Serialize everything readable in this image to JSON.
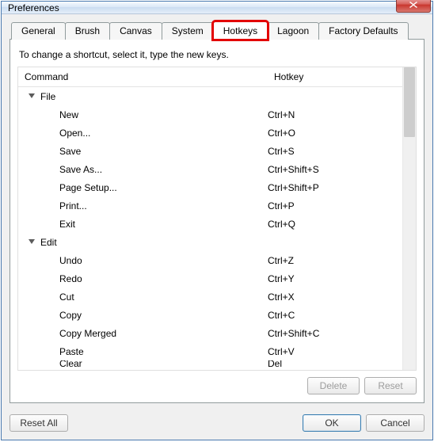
{
  "window": {
    "title": "Preferences"
  },
  "tabs": [
    {
      "label": "General"
    },
    {
      "label": "Brush"
    },
    {
      "label": "Canvas"
    },
    {
      "label": "System"
    },
    {
      "label": "Hotkeys",
      "active": true,
      "highlighted": true
    },
    {
      "label": "Lagoon"
    },
    {
      "label": "Factory Defaults"
    }
  ],
  "instruction": "To change a shortcut, select it, type the new keys.",
  "columns": {
    "command": "Command",
    "hotkey": "Hotkey"
  },
  "rows": [
    {
      "type": "group",
      "label": "File"
    },
    {
      "type": "item",
      "label": "New",
      "hotkey": "Ctrl+N"
    },
    {
      "type": "item",
      "label": "Open...",
      "hotkey": "Ctrl+O"
    },
    {
      "type": "item",
      "label": "Save",
      "hotkey": "Ctrl+S"
    },
    {
      "type": "item",
      "label": "Save As...",
      "hotkey": "Ctrl+Shift+S"
    },
    {
      "type": "item",
      "label": "Page Setup...",
      "hotkey": "Ctrl+Shift+P"
    },
    {
      "type": "item",
      "label": "Print...",
      "hotkey": "Ctrl+P"
    },
    {
      "type": "item",
      "label": "Exit",
      "hotkey": "Ctrl+Q"
    },
    {
      "type": "group",
      "label": "Edit"
    },
    {
      "type": "item",
      "label": "Undo",
      "hotkey": "Ctrl+Z"
    },
    {
      "type": "item",
      "label": "Redo",
      "hotkey": "Ctrl+Y"
    },
    {
      "type": "item",
      "label": "Cut",
      "hotkey": "Ctrl+X"
    },
    {
      "type": "item",
      "label": "Copy",
      "hotkey": "Ctrl+C"
    },
    {
      "type": "item",
      "label": "Copy Merged",
      "hotkey": "Ctrl+Shift+C"
    },
    {
      "type": "item",
      "label": "Paste",
      "hotkey": "Ctrl+V"
    },
    {
      "type": "item",
      "label": "Clear",
      "hotkey": "Del",
      "clipped": true
    }
  ],
  "actions": {
    "delete": "Delete",
    "reset": "Reset"
  },
  "footer": {
    "resetAll": "Reset All",
    "ok": "OK",
    "cancel": "Cancel"
  }
}
